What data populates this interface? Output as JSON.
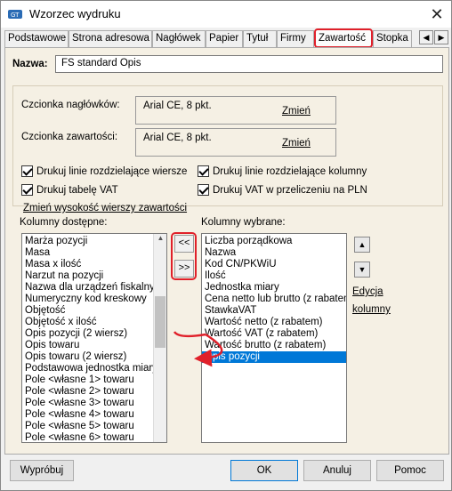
{
  "window": {
    "title": "Wzorzec wydruku",
    "close_glyph": "✕"
  },
  "tabs": [
    "Podstawowe",
    "Strona adresowa",
    "Nagłówek",
    "Papier",
    "Tytuł",
    "Firmy",
    "Zawartość",
    "Stopka"
  ],
  "active_tab": "Zawartość",
  "tab_nav": {
    "left": "◀",
    "right": "▶"
  },
  "form": {
    "name_label": "Nazwa:",
    "name_value": "FS standard Opis",
    "header_font_label": "Czcionka nagłówków:",
    "header_font_value": "Arial CE, 8 pkt.",
    "header_font_change": "Zmień",
    "content_font_label": "Czcionka zawartości:",
    "content_font_value": "Arial CE, 8 pkt.",
    "content_font_change": "Zmień"
  },
  "checkboxes": {
    "row_lines": "Drukuj linie rozdzielające wiersze",
    "col_lines": "Drukuj linie rozdzielające kolumny",
    "vat_table": "Drukuj tabelę VAT",
    "vat_pln": "Drukuj VAT w przeliczeniu na PLN"
  },
  "change_row_height": "Zmień wysokość wierszy zawartości",
  "available": {
    "label": "Kolumny dostępne:",
    "items": [
      "Marża pozycji",
      "Masa",
      "Masa x ilość",
      "Narzut na pozycji",
      "Nazwa dla urządzeń fiskalnych",
      "Numeryczny kod kreskowy",
      "Objętość",
      "Objętość x ilość",
      "Opis pozycji (2 wiersz)",
      "Opis towaru",
      "Opis towaru (2 wiersz)",
      "Podstawowa jednostka miary",
      "Pole <własne 1> towaru",
      "Pole <własne 2> towaru",
      "Pole <własne 3> towaru",
      "Pole <własne 4> towaru",
      "Pole <własne 5> towaru",
      "Pole <własne 6> towaru"
    ]
  },
  "move_buttons": {
    "add": "<<",
    "remove": ">>"
  },
  "selected": {
    "label": "Kolumny wybrane:",
    "items": [
      "Liczba porządkowa",
      "Nazwa",
      "Kod CN/PKWiU",
      "Ilość",
      "Jednostka miary",
      "Cena netto lub brutto (z rabatem",
      "StawkaVAT",
      "Wartość netto (z rabatem)",
      "Wartość VAT (z rabatem)",
      "Wartość brutto (z rabatem)",
      "Opis pozycji"
    ],
    "selected_item": "Opis pozycji"
  },
  "order_buttons": {
    "up": "▲",
    "down": "▼"
  },
  "edit_link": {
    "line1": "Edycja",
    "line2": "kolumny"
  },
  "buttons": {
    "preview": "Wypróbuj",
    "ok": "OK",
    "cancel": "Anuluj",
    "help": "Pomoc"
  },
  "colors": {
    "highlight": "#e0202a",
    "selection": "#0078d7",
    "panel": "#f5f0e4"
  }
}
